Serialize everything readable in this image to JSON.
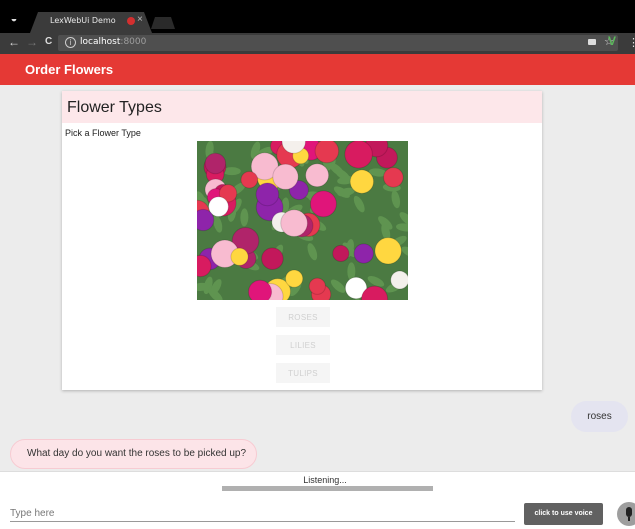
{
  "browser": {
    "tab_title": "LexWebUi Demo",
    "tab_close": "×",
    "url_host": "localhost",
    "url_port": ":8000",
    "back": "←",
    "forward": "→",
    "reload": "C",
    "info": "i",
    "star": "☆",
    "ext": "V",
    "menu": "⋮"
  },
  "appbar": {
    "title": "Order Flowers",
    "color": "#e53935"
  },
  "card": {
    "title": "Flower Types",
    "subtitle": "Pick a Flower Type",
    "buttons": [
      "ROSES",
      "LILIES",
      "TULIPS"
    ]
  },
  "messages": {
    "human": "roses",
    "bot": "What day do you want the roses to be picked up?"
  },
  "footer": {
    "status": "Listening...",
    "input_placeholder": "Type here",
    "mic_tooltip": "click to use voice",
    "progress": 1.0
  }
}
